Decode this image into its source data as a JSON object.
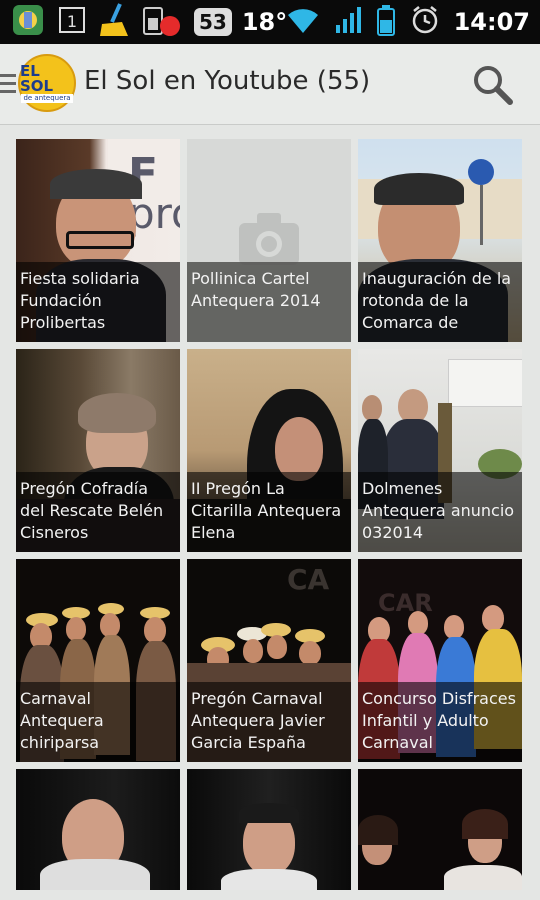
{
  "status_bar": {
    "notification_count": "53",
    "temperature": "18°",
    "time": "14:07"
  },
  "action_bar": {
    "logo_text": "EL SOL",
    "logo_subtext": "de antequera",
    "title": "El Sol en Youtube (55)"
  },
  "videos": [
    {
      "title": "Fiesta solidaria Fundación Prolibertas"
    },
    {
      "title": "Pollinica Cartel Antequera 2014"
    },
    {
      "title": "Inauguración de la rotonda de la Comarca de"
    },
    {
      "title": "Pregón Cofradía del Rescate Belén Cisneros"
    },
    {
      "title": "II Pregón La Citarilla Antequera Elena"
    },
    {
      "title": "Dolmenes Antequera anuncio 032014"
    },
    {
      "title": "Carnaval Antequera chiriparsa"
    },
    {
      "title": "Pregón Carnaval Antequera Javier Garcia España"
    },
    {
      "title": "Concurso Disfraces Infantil y Adulto Carnaval"
    }
  ],
  "colors": {
    "status_bar_bg": "#0a0a0a",
    "action_bar_bg": "#e9ebe9",
    "wifi": "#2fb7e6",
    "caption_overlay": "rgba(0,0,0,0.58)"
  }
}
